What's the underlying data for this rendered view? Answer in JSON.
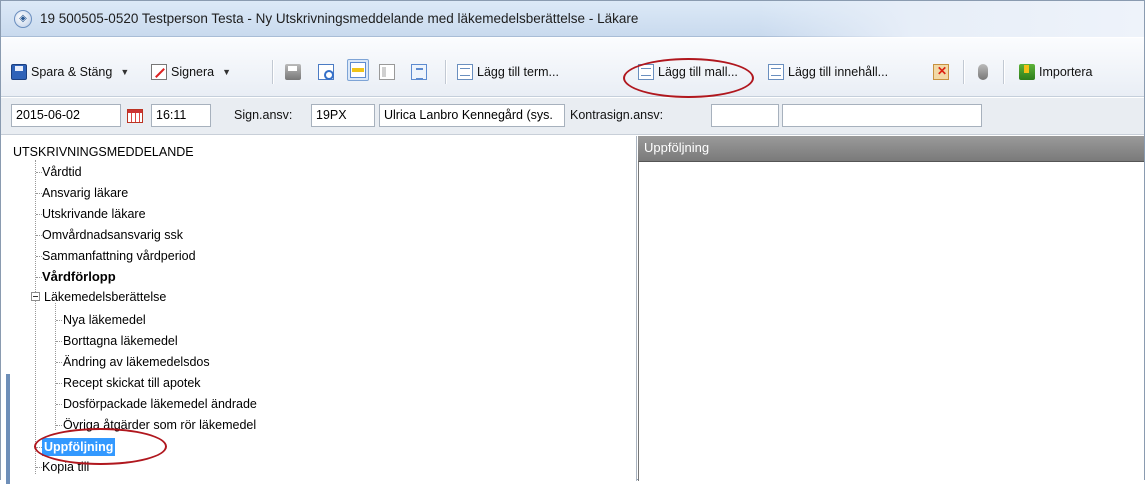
{
  "window": {
    "title": "19 500505-0520 Testperson Testa - Ny Utskrivningsmeddelande med läkemedelsberättelse - Läkare"
  },
  "toolbar": {
    "save_label": "Spara & Stäng",
    "sign_label": "Signera",
    "add_term_label": "Lägg till term...",
    "add_template_label": "Lägg till mall...",
    "add_content_label": "Lägg till innehåll...",
    "import_label": "Importera",
    "icons": [
      "save-icon",
      "sign-icon",
      "print-icon",
      "preview-icon",
      "layout-icon",
      "panel-icon",
      "list-icon",
      "add-term-icon",
      "add-template-icon",
      "add-content-icon",
      "delete-icon",
      "microphone-icon",
      "import-icon"
    ]
  },
  "info": {
    "date": "2015-06-02",
    "time": "16:11",
    "sign_label": "Sign.ansv:",
    "sign_code": "19PX",
    "sign_name": "Ulrica Lanbro Kennegård (sys.",
    "countersign_label": "Kontrasign.ansv:",
    "countersign_code": "",
    "countersign_name": ""
  },
  "tree": {
    "root": "UTSKRIVNINGSMEDDELANDE",
    "items": [
      "Vårdtid",
      "Ansvarig läkare",
      "Utskrivande läkare",
      "Omvårdnadsansvarig ssk",
      "Sammanfattning vårdperiod",
      "Vårdförlopp",
      "Läkemedelsberättelse"
    ],
    "subitems": [
      "Nya läkemedel",
      "Borttagna läkemedel",
      "Ändring av läkemedelsdos",
      "Recept skickat till apotek",
      "Dosförpackade läkemedel ändrade",
      "Övriga åtgärder som rör läkemedel"
    ],
    "selected": "Uppföljning",
    "last": "Kopia till"
  },
  "panel": {
    "header": "Uppföljning"
  },
  "highlight_color": "#b0171e",
  "selection_color": "#3399ff"
}
